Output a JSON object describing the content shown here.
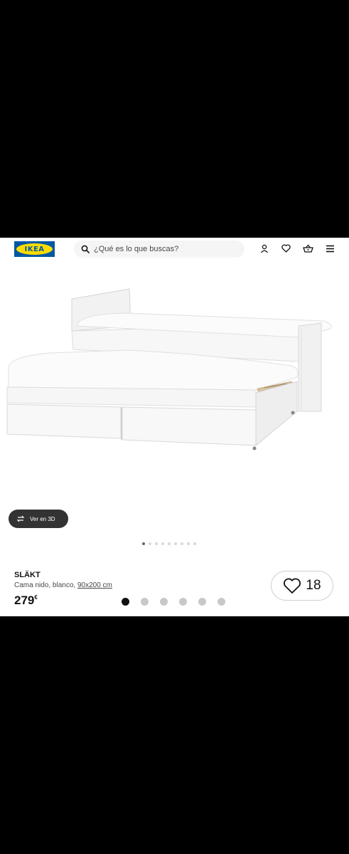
{
  "header": {
    "logo_text": "IKEA",
    "search_placeholder": "¿Qué es lo que buscas?",
    "icons": [
      "user-icon",
      "heart-icon",
      "basket-icon",
      "menu-icon"
    ]
  },
  "gallery": {
    "view_3d_label": "Ver en 3D",
    "image_count": 9,
    "active_image": 0
  },
  "product": {
    "name": "SLÄKT",
    "description": "Cama nido, blanco, ",
    "size": "90x200 cm",
    "price": "279",
    "currency": "€"
  },
  "favorites": {
    "count": "18"
  },
  "pager": {
    "count": 6,
    "active": 0
  }
}
